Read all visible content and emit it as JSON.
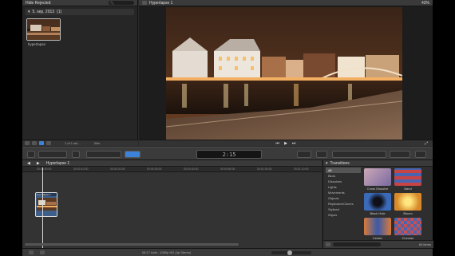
{
  "browser": {
    "filter_label": "Hide Rejected",
    "event_name": "5. sep. 2013",
    "event_count": "(1)",
    "clip_name": "hyperlapse",
    "footer_counter": "1 of 1 sel...",
    "footer_duration": "30m"
  },
  "viewer": {
    "title": "Hyperlapse 1",
    "zoom": "43%"
  },
  "toolbar": {
    "timecode": "2:15"
  },
  "timeline": {
    "title": "Hyperlapse 1",
    "clip_title": "Hyperlapse 1",
    "ruler": [
      "00:00:00:00",
      "00:00:10:00",
      "00:00:20:00",
      "00:00:30:00",
      "00:00:40:00",
      "00:00:50:00",
      "00:01:00:00",
      "00:01:10:00"
    ]
  },
  "transitions": {
    "title": "Transitions",
    "categories": [
      "All",
      "Blurs",
      "Dissolves",
      "Lights",
      "Movements",
      "Objects",
      "Replicator/Clones",
      "Stylized",
      "Wipes"
    ],
    "items": [
      "Cross Dissolve",
      "Band",
      "Black Hole",
      "Bloom",
      "Center",
      "Checker"
    ],
    "count": "84 items"
  },
  "statusbar": {
    "info": "08:17 total - 1080p HD (4p Stereo)"
  },
  "colors": {
    "accent": "#3b82d8",
    "panel": "#2a2a2a"
  }
}
